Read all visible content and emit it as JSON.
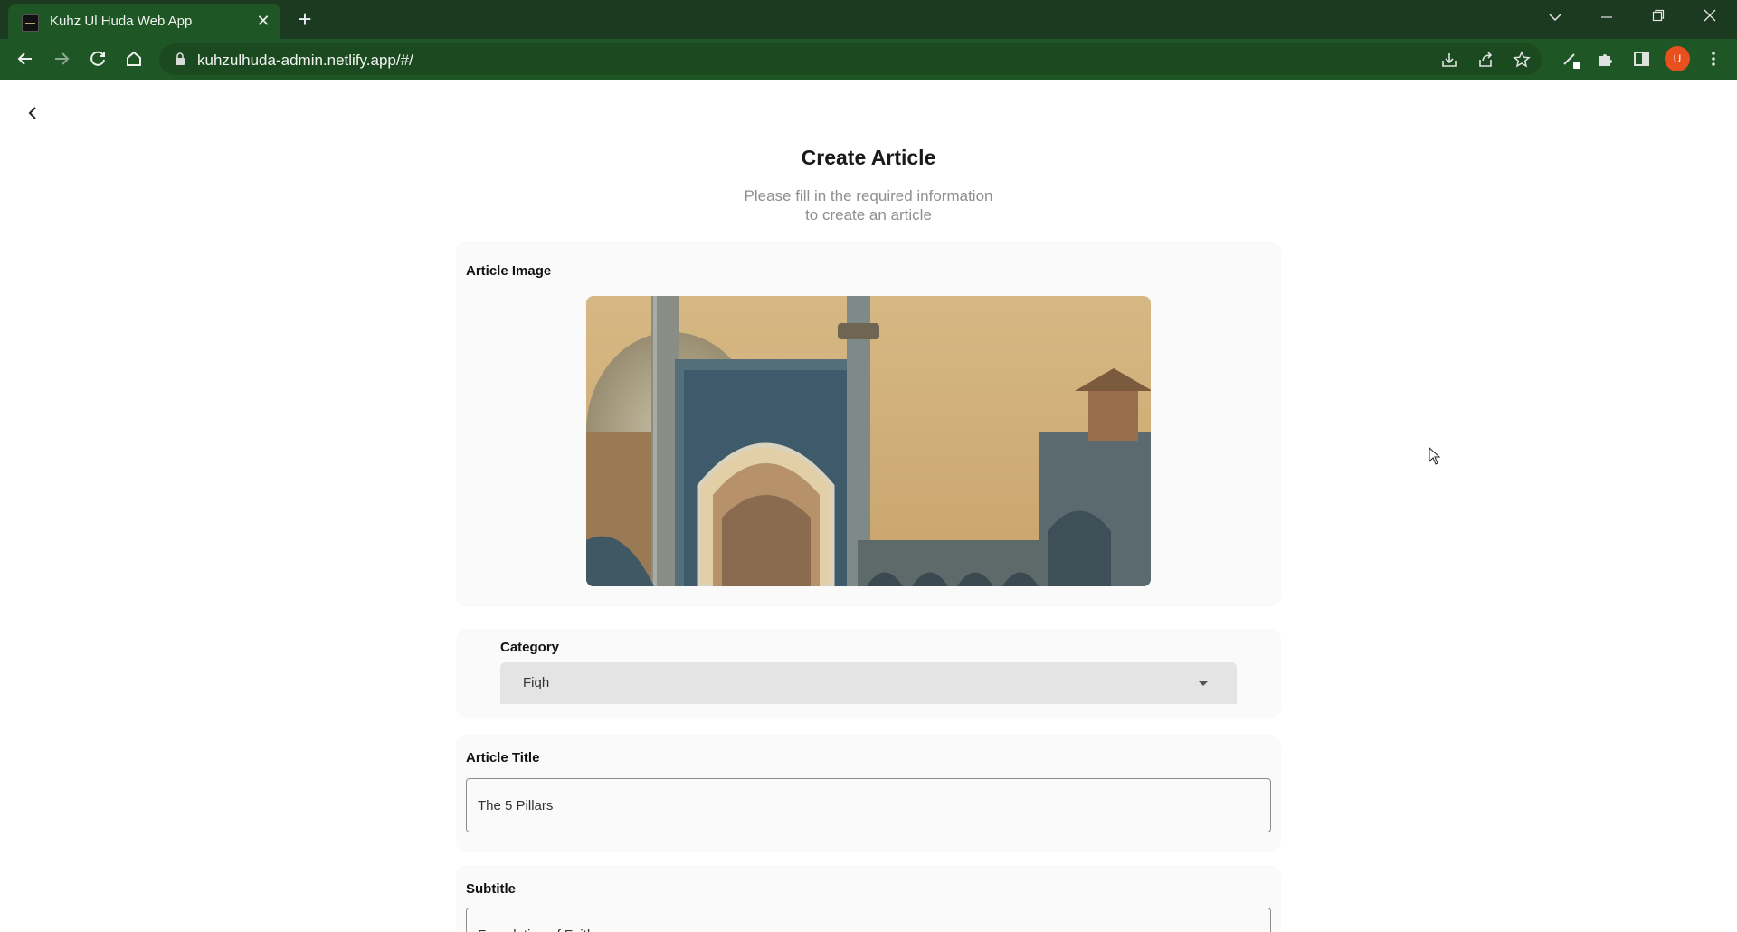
{
  "browser": {
    "tab_title": "Kuhz Ul Huda Web App",
    "url": "kuhzulhuda-admin.netlify.app/#/",
    "profile_initial": "U"
  },
  "page": {
    "title": "Create Article",
    "subtitle_line1": "Please fill in the required information",
    "subtitle_line2": "to create an article",
    "image_section": {
      "label": "Article Image",
      "image_icon": "mosque-photo"
    },
    "category": {
      "label": "Category",
      "value": "Fiqh"
    },
    "article_title": {
      "label": "Article Title",
      "value": "The 5 Pillars"
    },
    "subtitle_field": {
      "label": "Subtitle",
      "value": "Foundation of Faith"
    }
  },
  "colors": {
    "tab_bar": "#1c3a1f",
    "toolbar": "#1f5625",
    "card_bg": "#fafafa",
    "select_bg": "#e4e4e4",
    "avatar": "#e8501f"
  }
}
